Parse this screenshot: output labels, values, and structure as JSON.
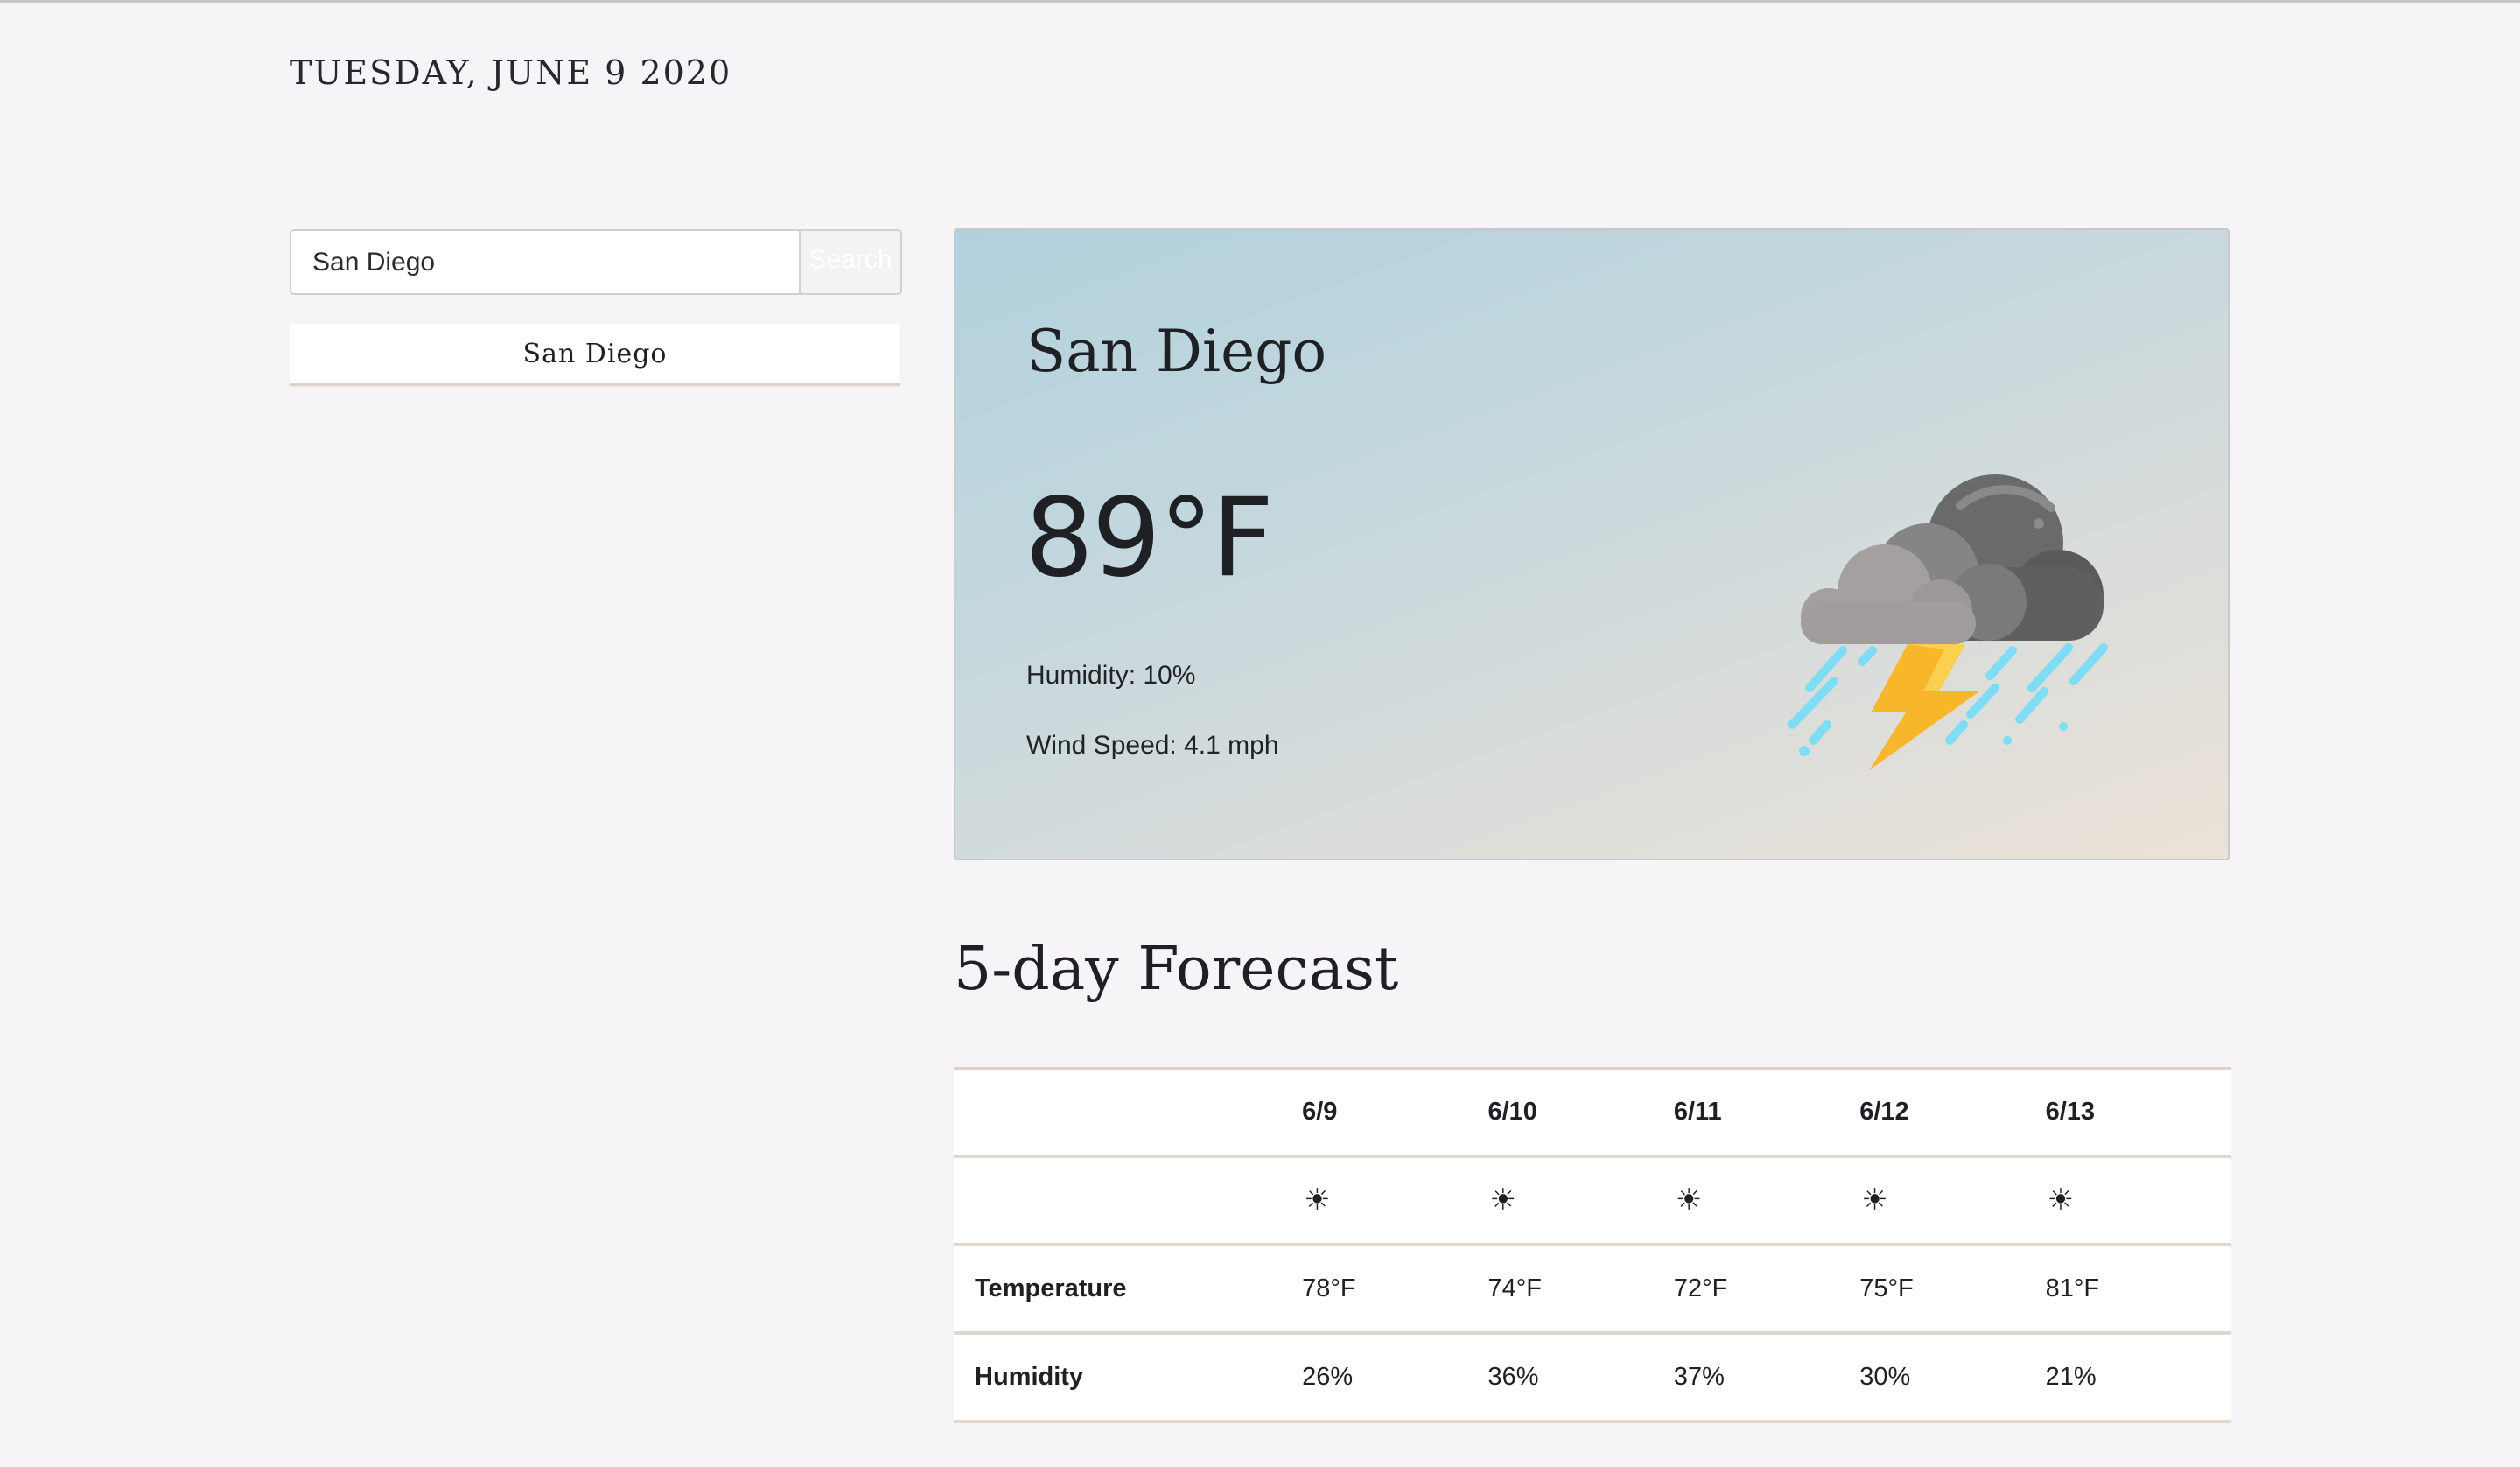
{
  "header": {
    "date": "TUESDAY, JUNE 9 2020"
  },
  "sidebar": {
    "search": {
      "value": "San Diego",
      "button_label": "Search"
    },
    "history": [
      {
        "label": "San Diego"
      }
    ]
  },
  "current": {
    "city": "San Diego",
    "temperature": "89°F",
    "humidity": "Humidity: 10%",
    "wind": "Wind Speed: 4.1 mph",
    "icon": "thunderstorm-rain-cloud-icon"
  },
  "forecast": {
    "heading": "5-day Forecast",
    "days": [
      {
        "date": "6/9",
        "icon": "☀",
        "temperature": "78°F",
        "humidity": "26%"
      },
      {
        "date": "6/10",
        "icon": "☀",
        "temperature": "74°F",
        "humidity": "36%"
      },
      {
        "date": "6/11",
        "icon": "☀",
        "temperature": "72°F",
        "humidity": "37%"
      },
      {
        "date": "6/12",
        "icon": "☀",
        "temperature": "75°F",
        "humidity": "30%"
      },
      {
        "date": "6/13",
        "icon": "☀",
        "temperature": "81°F",
        "humidity": "21%"
      }
    ],
    "row_labels": {
      "temperature": "Temperature",
      "humidity": "Humidity"
    }
  },
  "colors": {
    "page_background": "#f6f4f7",
    "card_gradient_start": "#b2d1dd",
    "card_gradient_end": "#ebe2d8",
    "table_border": "#e0d7cf",
    "bolt": "#f8b72b",
    "rain": "#7fdcf5"
  }
}
